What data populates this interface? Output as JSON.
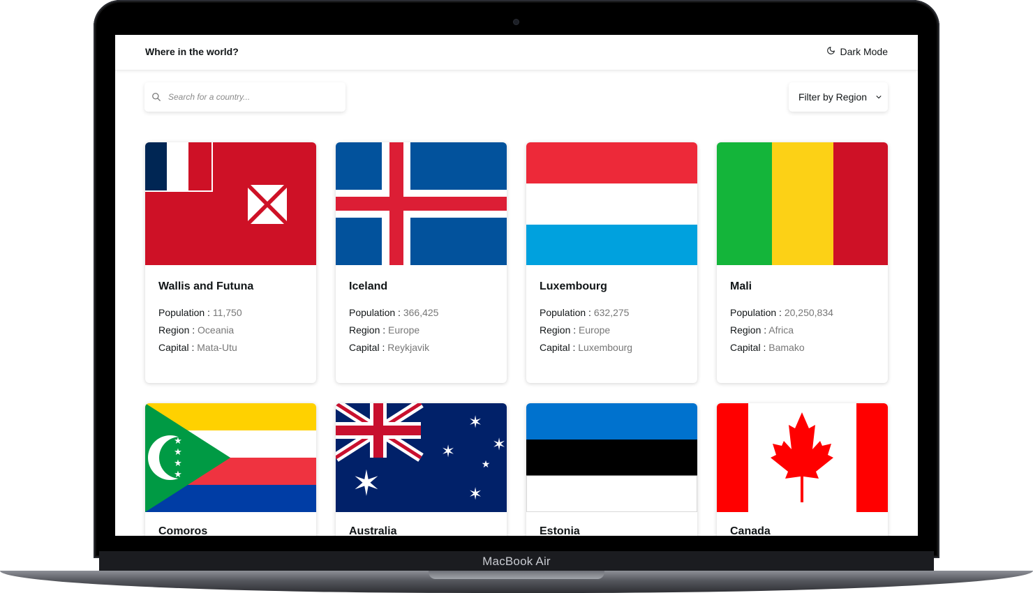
{
  "device": {
    "label": "MacBook Air"
  },
  "header": {
    "title": "Where in the world?",
    "dark_mode_label": "Dark Mode",
    "moon_icon": "moon-icon"
  },
  "search": {
    "placeholder": "Search for a country...",
    "value": "",
    "icon": "search-icon"
  },
  "filter": {
    "label": "Filter by Region",
    "icon": "chevron-down-icon"
  },
  "labels": {
    "population": "Population :",
    "region": "Region :",
    "capital": "Capital :"
  },
  "colors": {
    "text": "#111517",
    "muted": "#777777",
    "background": "#ffffff"
  },
  "countries": [
    {
      "name": "Wallis and Futuna",
      "population": "11,750",
      "region": "Oceania",
      "capital": "Mata-Utu"
    },
    {
      "name": "Iceland",
      "population": "366,425",
      "region": "Europe",
      "capital": "Reykjavik"
    },
    {
      "name": "Luxembourg",
      "population": "632,275",
      "region": "Europe",
      "capital": "Luxembourg"
    },
    {
      "name": "Mali",
      "population": "20,250,834",
      "region": "Africa",
      "capital": "Bamako"
    },
    {
      "name": "Comoros"
    },
    {
      "name": "Australia"
    },
    {
      "name": "Estonia"
    },
    {
      "name": "Canada"
    }
  ]
}
